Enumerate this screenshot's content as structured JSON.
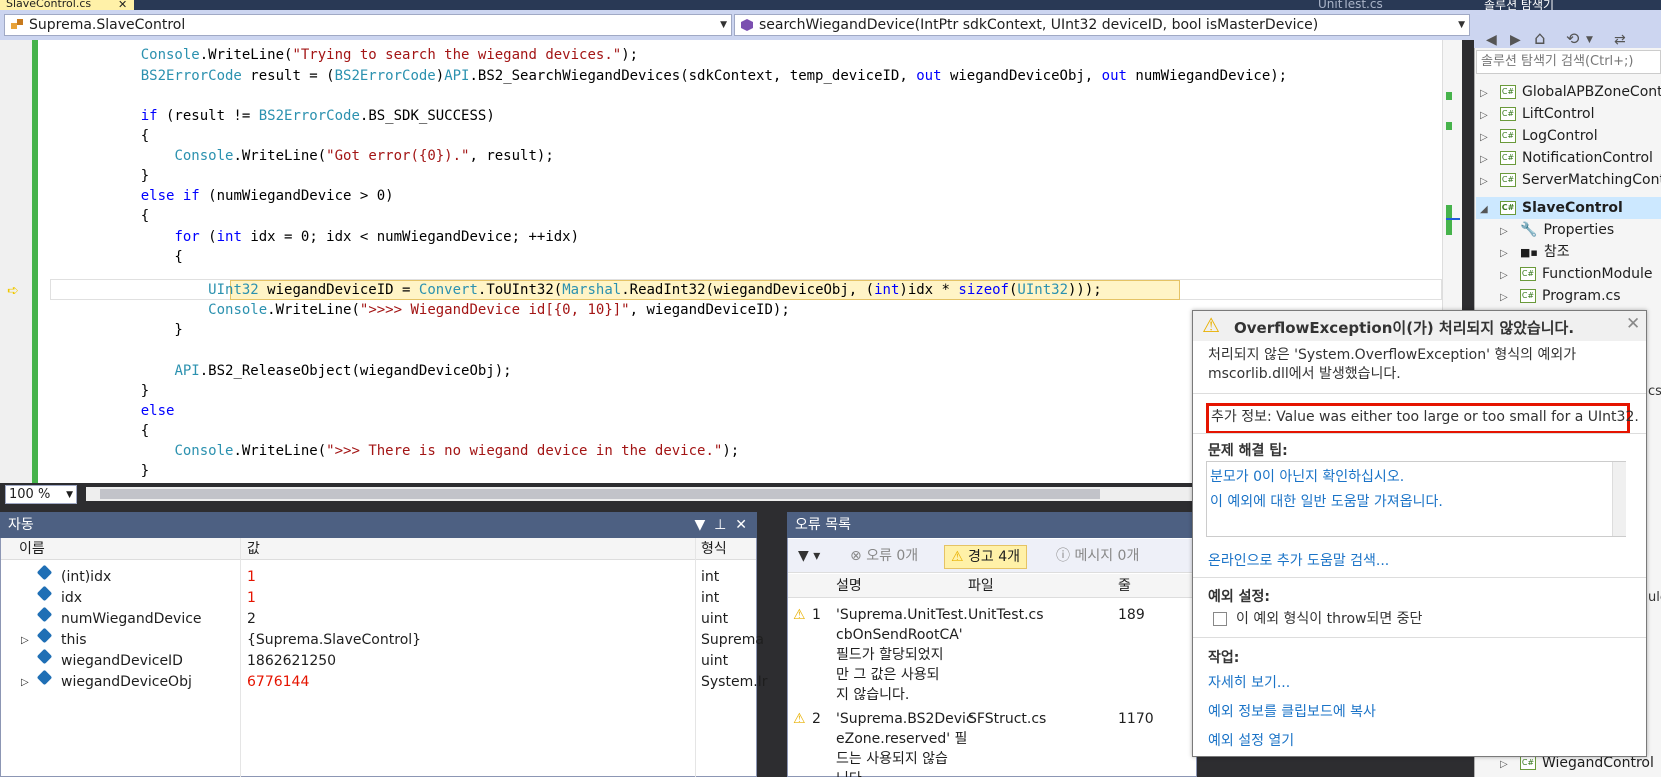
{
  "tabs": {
    "active_doc": "SlaveControl.cs",
    "other_doc": "UnitTest.cs",
    "right_panel": "솔루션 탐색기"
  },
  "nav": {
    "class_selector": "Suprema.SlaveControl",
    "member_selector": "searchWiegandDevice(IntPtr sdkContext, UInt32 deviceID, bool isMasterDevice)"
  },
  "editor": {
    "zoom": "100 %"
  },
  "solution_explorer": {
    "search_placeholder": "솔루션 탐색기 검색(Ctrl+;)",
    "items": [
      {
        "label": "GlobalAPBZoneControl"
      },
      {
        "label": "LiftControl"
      },
      {
        "label": "LogControl"
      },
      {
        "label": "NotificationControl"
      },
      {
        "label": "ServerMatchingControl"
      },
      {
        "label": "SlaveControl"
      },
      {
        "label": "Properties"
      },
      {
        "label": "참조"
      },
      {
        "label": "FunctionModule"
      },
      {
        "label": "Program.cs"
      },
      {
        "label": "WiegandControl"
      }
    ],
    "partial_texts": [
      "cs",
      "ule"
    ]
  },
  "auto_window": {
    "title": "자동",
    "columns": [
      "이름",
      "값",
      "형식"
    ],
    "rows": [
      {
        "name": "(int)idx",
        "value": "1",
        "type": "int"
      },
      {
        "name": "idx",
        "value": "1",
        "type": "int"
      },
      {
        "name": "numWiegandDevice",
        "value": "2",
        "type": "uint"
      },
      {
        "name": "this",
        "value": "{Suprema.SlaveControl}",
        "type": "Suprema"
      },
      {
        "name": "wiegandDeviceID",
        "value": "1862621250",
        "type": "uint"
      },
      {
        "name": "wiegandDeviceObj",
        "value": "6776144",
        "type": "System.Ir"
      }
    ]
  },
  "error_list": {
    "title": "오류 목록",
    "errors_btn": "오류 0개",
    "warnings_btn": "경고 4개",
    "messages_btn": "메시지 0개",
    "columns": [
      "설명",
      "파일",
      "줄"
    ],
    "rows": [
      {
        "num": "1",
        "desc": [
          "'Suprema.UnitTest.",
          "cbOnSendRootCA'",
          "필드가 할당되었지",
          "만 그 값은 사용되",
          "지 않습니다."
        ],
        "file": "UnitTest.cs",
        "line": "189"
      },
      {
        "num": "2",
        "desc": [
          "'Suprema.BS2Devic",
          "eZone.reserved' 필",
          "드는 사용되지 않습",
          "니다"
        ],
        "file": "SFStruct.cs",
        "line": "1170"
      }
    ]
  },
  "exception": {
    "title": "OverflowException이(가) 처리되지 않았습니다.",
    "desc_line1": "처리되지 않은 'System.OverflowException' 형식의 예외가",
    "desc_line2": "mscorlib.dll에서 발생했습니다.",
    "info": "추가 정보: Value was either too large or too small for a UInt32.",
    "tips_title": "문제 해결 팁:",
    "tips": [
      "분모가 0이 아닌지 확인하십시오.",
      "이 예외에 대한 일반 도움말 가져옵니다."
    ],
    "online_help": "온라인으로 추가 도움말 검색...",
    "settings_title": "예외 설정:",
    "settings_checkbox": "이 예외 형식이 throw되면 중단",
    "actions_title": "작업:",
    "actions": [
      "자세히 보기...",
      "예외 정보를 클립보드에 복사",
      "예외 설정 열기"
    ]
  },
  "colors": {
    "accent": "#4d6082",
    "highlight": "#fff4c6",
    "error_box": "#e51400"
  }
}
